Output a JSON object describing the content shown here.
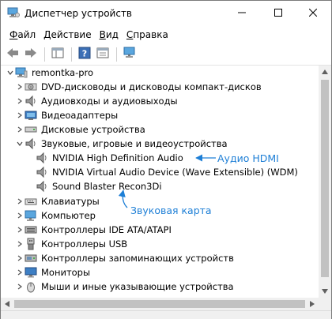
{
  "window": {
    "title": "Диспетчер устройств",
    "controls": {
      "minimize": "─",
      "maximize": "☐",
      "close": "✕"
    }
  },
  "menu": [
    {
      "accel": "Ф",
      "rest": "айл"
    },
    {
      "accel": "Д",
      "rest": "ействие"
    },
    {
      "accel": "В",
      "rest": "ид"
    },
    {
      "accel": "С",
      "rest": "правка"
    }
  ],
  "tree": {
    "root": "remontka-pro",
    "categories": [
      {
        "label": "DVD-дисководы и дисководы компакт-дисков",
        "icon": "dvd-drive-icon",
        "expanded": false
      },
      {
        "label": "Аудиовходы и аудиовыходы",
        "icon": "speaker-icon",
        "expanded": false
      },
      {
        "label": "Видеоадаптеры",
        "icon": "display-adapter-icon",
        "expanded": false
      },
      {
        "label": "Дисковые устройства",
        "icon": "disk-drive-icon",
        "expanded": false
      },
      {
        "label": "Звуковые, игровые и видеоустройства",
        "icon": "speaker-icon",
        "expanded": true
      },
      {
        "label": "Клавиатуры",
        "icon": "keyboard-icon",
        "expanded": false
      },
      {
        "label": "Компьютер",
        "icon": "computer-icon",
        "expanded": false
      },
      {
        "label": "Контроллеры IDE ATA/ATAPI",
        "icon": "ide-controller-icon",
        "expanded": false
      },
      {
        "label": "Контроллеры USB",
        "icon": "usb-icon",
        "expanded": false
      },
      {
        "label": "Контроллеры запоминающих устройств",
        "icon": "storage-controller-icon",
        "expanded": false
      },
      {
        "label": "Мониторы",
        "icon": "monitor-icon",
        "expanded": false
      },
      {
        "label": "Мыши и иные указывающие устройства",
        "icon": "mouse-icon",
        "expanded": false
      }
    ],
    "sound_devices": [
      "NVIDIA High Definition Audio",
      "NVIDIA Virtual Audio Device (Wave Extensible) (WDM)",
      "Sound Blaster Recon3Di"
    ]
  },
  "annotations": {
    "hdmi": "Аудио HDMI",
    "card": "Звуковая карта",
    "color": "#1e7fd6"
  }
}
